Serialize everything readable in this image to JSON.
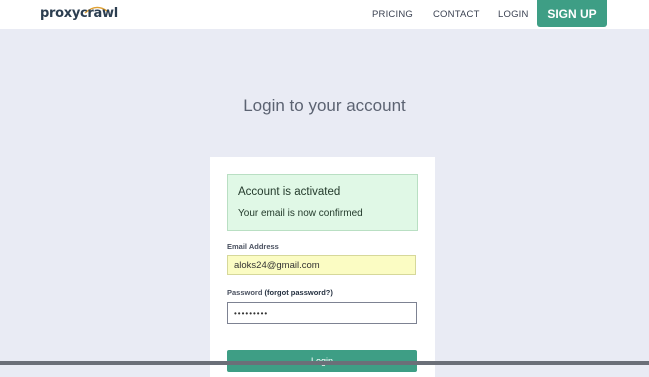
{
  "header": {
    "logo": "proxycrawl",
    "nav": {
      "pricing": "PRICING",
      "contact": "CONTACT",
      "login": "LOGIN",
      "signup": "SIGN UP"
    }
  },
  "page": {
    "title": "Login to your account"
  },
  "alert": {
    "title": "Account is activated",
    "message": "Your email is now confirmed"
  },
  "form": {
    "email_label": "Email Address",
    "email_value": "aloks24@gmail.com",
    "password_label": "Password",
    "forgot_link": "(forgot password?)",
    "password_mask": "•••••••••",
    "submit_label": "Login"
  },
  "colors": {
    "accent": "#3e9e85",
    "background": "#e9ebf4",
    "alert_bg": "#e0f8e6",
    "autofill_bg": "#fbfcc3"
  }
}
